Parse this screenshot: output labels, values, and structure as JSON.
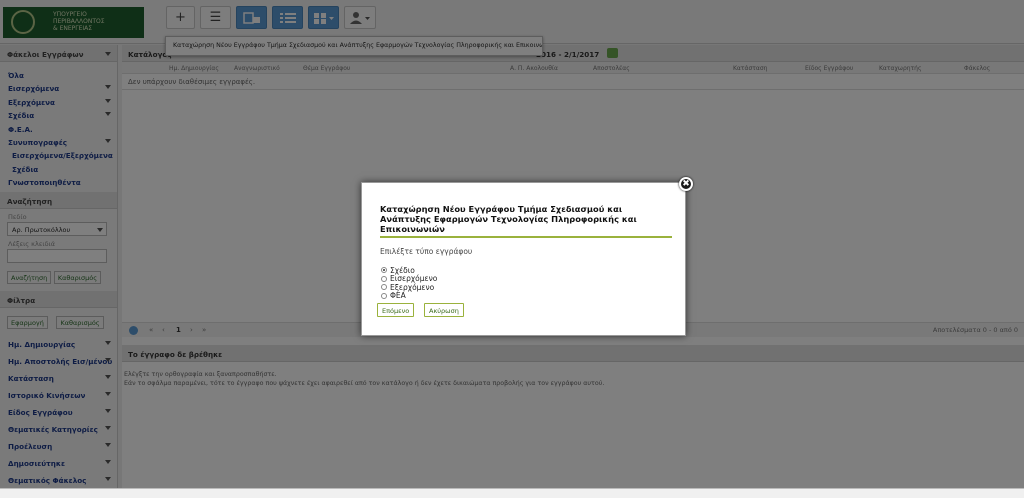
{
  "logo": {
    "line1": "ΥΠΟΥΡΓΕΙΟ",
    "line2": "ΠΕΡΙΒΑΛΛΟΝΤΟΣ",
    "line3": "& ΕΝΕΡΓΕΙΑΣ"
  },
  "toolbar": {
    "add_label": "+",
    "list_label": "☰",
    "tooltip": "Καταχώρηση Νέου Εγγράφου Τμήμα Σχεδιασμού και Ανάπτυξης Εφαρμογών Τεχνολογίας Πληροφορικής και Επικοινωνιών"
  },
  "sidebar": {
    "folders_title": "Φάκελοι Εγγράφων",
    "items": [
      {
        "label": "Όλα",
        "expandable": false
      },
      {
        "label": "Εισερχόμενα",
        "expandable": true
      },
      {
        "label": "Εξερχόμενα",
        "expandable": true
      },
      {
        "label": "Σχέδια",
        "expandable": true
      },
      {
        "label": "Φ.Ε.Α.",
        "expandable": false
      },
      {
        "label": "Συνυπογραφές",
        "expandable": true
      },
      {
        "label": "Εισερχόμενα/Εξερχόμενα",
        "expandable": false
      },
      {
        "label": "Σχέδια",
        "expandable": false
      },
      {
        "label": "Γνωστοποιηθέντα",
        "expandable": false
      }
    ],
    "search_title": "Αναζήτηση",
    "field_label": "Πεδίο",
    "field_value": "Αρ. Πρωτοκόλλου",
    "keywords_label": "Λέξεις κλειδιά",
    "search_button": "Αναζήτηση",
    "clear_button": "Καθαρισμός",
    "filters_title": "Φίλτρα",
    "apply_button": "Εφαρμογή",
    "clear_filters_button": "Καθαρισμός",
    "filters": [
      "Ημ. Δημιουργίας",
      "Ημ. Αποστολής Εισ/μένου",
      "Κατάσταση",
      "Ιστορικό Κινήσεων",
      "Είδος Εγγράφου",
      "Θεματικές Κατηγορίες",
      "Προέλευση",
      "Δημοσιεύτηκε",
      "Θεματικός Φάκελος"
    ]
  },
  "main": {
    "title": "Κατάλογος",
    "date_range": "2016 - 2/1/2017",
    "columns": [
      "Ημ. Δημιουργίας",
      "Αναγνωριστικό",
      "Θέμα Εγγράφου",
      "Α. Π. Ακολουθία",
      "Αποστολέας",
      "Κατάσταση",
      "Είδος Εγγράφου",
      "Καταχωρητής",
      "Φάκελος"
    ],
    "no_records": "Δεν υπάρχουν διαθέσιμες εγγραφές.",
    "page": "1",
    "pager_info": "Αποτελέσματα 0 - 0 από 0",
    "not_found_title": "Το έγγραφο δε βρέθηκε",
    "not_found_line1": "Ελέγξτε την ορθογραφία και ξαναπροσπαθήστε.",
    "not_found_line2": "Εάν το σφάλμα παραμένει, τότε το έγγραφο που ψάχνετε έχει αφαιρεθεί από τον κατάλογο ή δεν έχετε δικαιώματα προβολής για τον εγγράφου αυτού."
  },
  "dialog": {
    "title": "Καταχώρηση Νέου Εγγράφου Τμήμα Σχεδιασμού και Ανάπτυξης Εφαρμογών Τεχνολογίας Πληροφορικής και Επικοινωνιών",
    "subtitle": "Επιλέξτε τύπο εγγράφου",
    "options": [
      "Σχέδιο",
      "Εισερχόμενο",
      "Εξερχόμενο",
      "ΦΕΑ"
    ],
    "selected": "Σχέδιο",
    "next_button": "Επόμενο",
    "cancel_button": "Ακύρωση",
    "close_label": "✖"
  },
  "colors": {
    "accent": "#9ab23c",
    "link": "#1e3a8a",
    "toolbar_blue": "#5b9bd5",
    "logo_green": "#1f5f2e"
  }
}
